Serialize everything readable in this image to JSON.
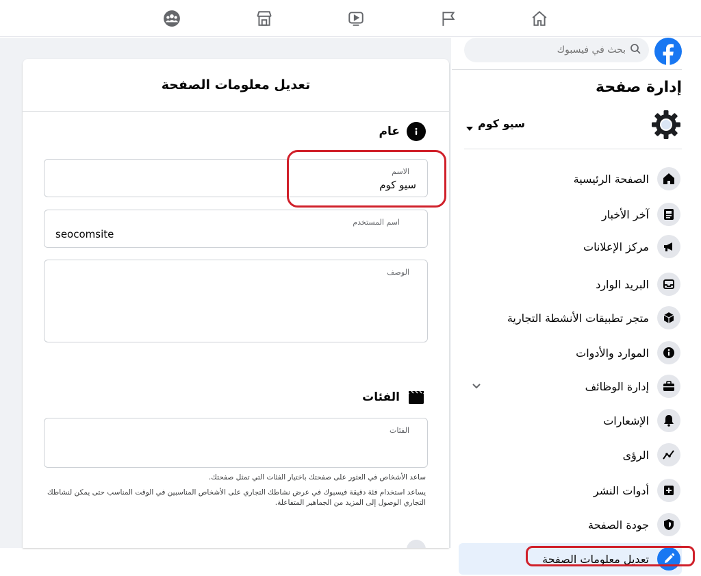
{
  "top_nav": {
    "icons": [
      "home-icon",
      "flag-icon",
      "video-icon",
      "marketplace-icon",
      "groups-icon"
    ]
  },
  "colors": {
    "accent": "#1877f2",
    "annotation_red": "#d0202a",
    "background": "#f0f2f5"
  },
  "edit_card": {
    "title": "تعديل معلومات الصفحة",
    "general": {
      "heading": "عام",
      "name_label": "الاسم",
      "name_value": "سيو كوم",
      "username_label": "اسم المستخدم",
      "username_value": "seocomsite",
      "description_label": "الوصف",
      "description_value": ""
    },
    "categories": {
      "heading": "الفئات",
      "field_label": "الفئات",
      "help_1": "ساعد الأشخاص في العثور على صفحتك باختيار الفئات التي تمثل صفحتك.",
      "help_2": "يساعد استخدام فئة دقيقة فيسبوك في عرض نشاطك التجاري على الأشخاص المناسبين في الوقت المناسب حتى يمكن لنشاطك التجاري الوصول إلى المزيد من الجماهير المتفاعلة."
    }
  },
  "sidebar": {
    "search_placeholder": "بحث في فيسبوك",
    "title": "إدارة صفحة",
    "page_name": "سيو كوم",
    "items": [
      {
        "label": "الصفحة الرئيسية",
        "icon": "home-icon"
      },
      {
        "label": "آخر الأخبار",
        "icon": "news-icon"
      },
      {
        "label": "مركز الإعلانات",
        "icon": "megaphone-icon"
      },
      {
        "label": "البريد الوارد",
        "icon": "inbox-icon"
      },
      {
        "label": "متجر تطبيقات الأنشطة التجارية",
        "icon": "cube-icon"
      },
      {
        "label": "الموارد والأدوات",
        "icon": "info-icon"
      },
      {
        "label": "إدارة الوظائف",
        "icon": "briefcase-icon"
      },
      {
        "label": "الإشعارات",
        "icon": "bell-icon"
      },
      {
        "label": "الرؤى",
        "icon": "insights-icon"
      },
      {
        "label": "أدوات النشر",
        "icon": "publishing-icon"
      },
      {
        "label": "جودة الصفحة",
        "icon": "shield-icon"
      },
      {
        "label": "تعديل معلومات الصفحة",
        "icon": "pencil-icon"
      }
    ]
  }
}
